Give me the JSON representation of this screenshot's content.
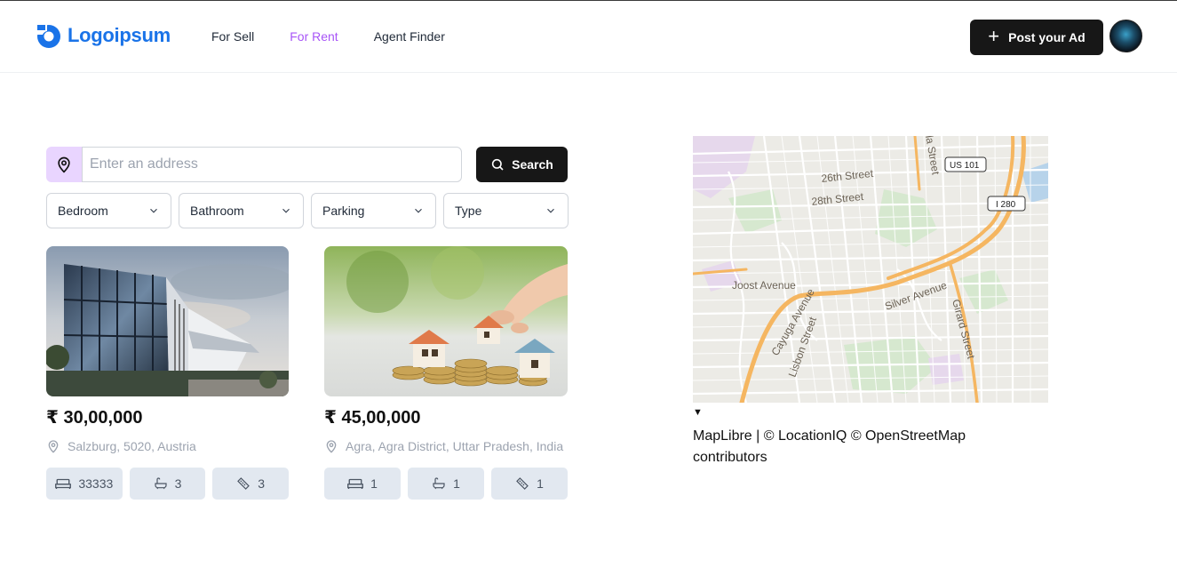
{
  "header": {
    "logo_text": "Logoipsum",
    "nav": [
      {
        "label": "For Sell",
        "active": false
      },
      {
        "label": "For Rent",
        "active": true
      },
      {
        "label": "Agent Finder",
        "active": false
      }
    ],
    "post_button_label": "Post your Ad"
  },
  "search": {
    "placeholder": "Enter an address",
    "value": "",
    "button_label": "Search"
  },
  "filters": [
    "Bedroom",
    "Bathroom",
    "Parking",
    "Type"
  ],
  "listings": [
    {
      "price": "₹ 30,00,000",
      "location": "Salzburg, 5020, Austria",
      "bedrooms": "33333",
      "bathrooms": "3",
      "area": "3"
    },
    {
      "price": "₹ 45,00,000",
      "location": "Agra, Agra District, Uttar Pradesh, India",
      "bedrooms": "1",
      "bathrooms": "1",
      "area": "1"
    }
  ],
  "map": {
    "labels": {
      "street_26th": "26th Street",
      "street_28th": "28th Street",
      "us101": "US 101",
      "i280": "I 280",
      "joost": "Joost Avenue",
      "silver": "Silver Avenue",
      "cayuga": "Cayuga Avenue",
      "lisbon": "Lisbon Street",
      "girard": "Girard Street",
      "top_street": "la Street"
    },
    "attribution_toggle": "▼",
    "attribution": "MapLibre | © LocationIQ © OpenStreetMap contributors"
  },
  "colors": {
    "accent": "#a855f7",
    "brand": "#1a73e8",
    "dark": "#171717",
    "pin_bg": "#e9d5ff"
  }
}
